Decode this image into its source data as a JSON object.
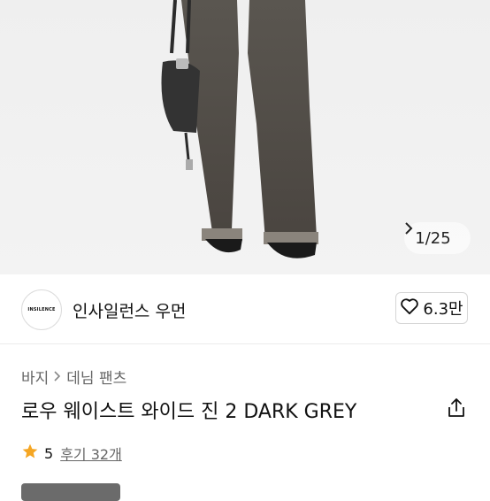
{
  "gallery": {
    "counter": "1/25",
    "next_icon": "chevron-right-icon"
  },
  "brand": {
    "logo_text": "INSILENCE",
    "name": "인사일런스 우먼",
    "like_count": "6.3만",
    "like_icon": "heart-outline-icon"
  },
  "breadcrumb": {
    "items": [
      "바지",
      "데님 팬츠"
    ]
  },
  "product": {
    "title": "로우 웨이스트 와이드 진 2 DARK GREY",
    "share_icon": "share-icon"
  },
  "rating": {
    "score": "5",
    "reviews_label": "후기 32개",
    "star_color": "#f5a623"
  },
  "colors": {
    "accent_star": "#f5a623",
    "text_primary": "#111111",
    "text_secondary": "#666666"
  }
}
